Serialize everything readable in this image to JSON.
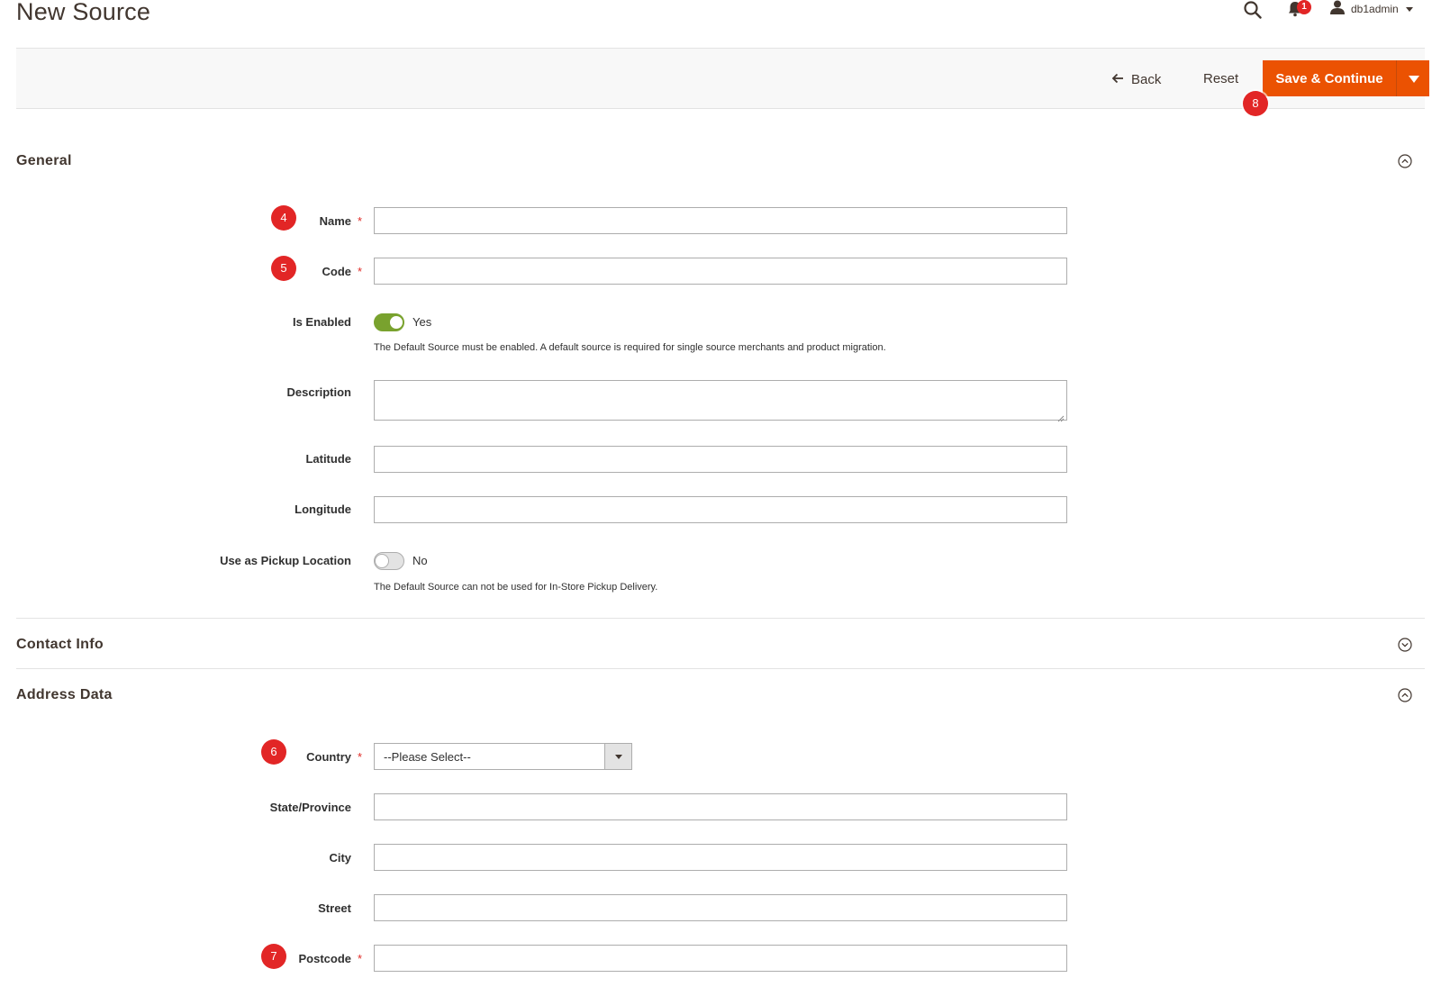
{
  "page": {
    "title": "New Source"
  },
  "header": {
    "notifications_count": "1",
    "username": "db1admin"
  },
  "actions": {
    "back_label": "Back",
    "reset_label": "Reset",
    "save_label": "Save & Continue"
  },
  "markers": {
    "name": "4",
    "code": "5",
    "country": "6",
    "postcode": "7",
    "save": "8"
  },
  "sections": {
    "general": "General",
    "contact_info": "Contact Info",
    "address_data": "Address Data"
  },
  "general": {
    "name_label": "Name",
    "code_label": "Code",
    "is_enabled_label": "Is Enabled",
    "is_enabled_value": "Yes",
    "is_enabled_note": "The Default Source must be enabled. A default source is required for single source merchants and product migration.",
    "description_label": "Description",
    "latitude_label": "Latitude",
    "longitude_label": "Longitude",
    "pickup_label": "Use as Pickup Location",
    "pickup_value": "No",
    "pickup_note": "The Default Source can not be used for In-Store Pickup Delivery."
  },
  "address": {
    "country_label": "Country",
    "country_value": "--Please Select--",
    "state_label": "State/Province",
    "city_label": "City",
    "street_label": "Street",
    "postcode_label": "Postcode"
  },
  "required_mark": "*",
  "colors": {
    "accent": "#eb5202",
    "marker": "#e22626",
    "toggle_on": "#79a22e",
    "required": "#e02b27"
  },
  "icons": {
    "search": "search-icon",
    "bell": "bell-icon",
    "user": "user-icon",
    "back": "arrow-left-icon",
    "collapse": "chevron-circle-icon"
  }
}
